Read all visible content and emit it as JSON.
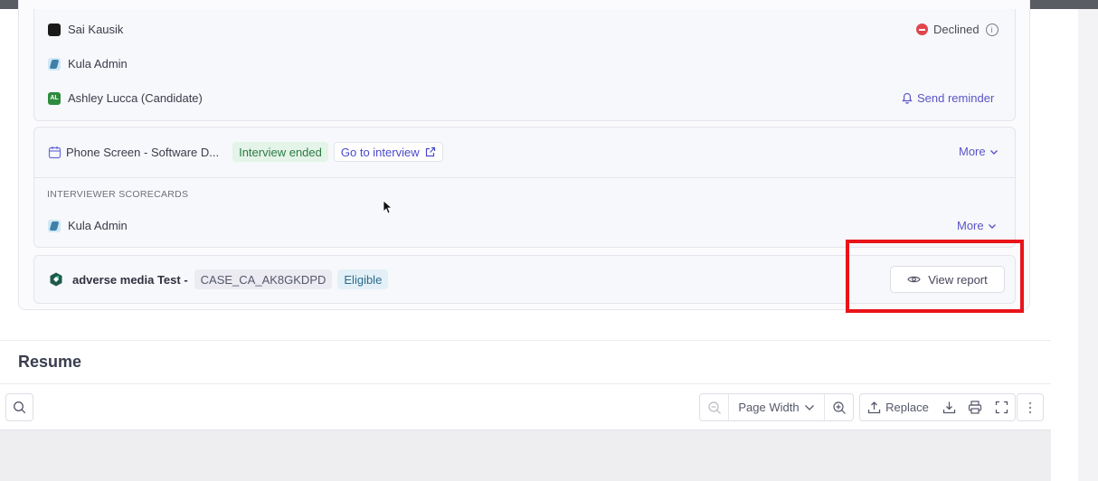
{
  "participants": [
    {
      "name": "Sai Kausik",
      "avatar": "black-logo",
      "status": "Declined"
    },
    {
      "name": "Kula Admin",
      "avatar": "kula-logo"
    },
    {
      "name": "Ashley Lucca (Candidate)",
      "avatar": "AL",
      "action": "Send reminder"
    }
  ],
  "interview": {
    "title": "Phone Screen - Software D...",
    "status_badge": "Interview ended",
    "go_label": "Go to interview",
    "more_label": "More",
    "scorecards_label": "INTERVIEWER SCORECARDS",
    "scorecard_name": "Kula Admin",
    "scorecard_more": "More"
  },
  "check": {
    "title": "adverse media Test -",
    "case_id": "CASE_CA_AK8GKDPD",
    "status": "Eligible",
    "view_report": "View report"
  },
  "resume": {
    "title": "Resume",
    "zoom_mode": "Page Width",
    "replace_label": "Replace"
  },
  "colors": {
    "accent": "#5a55c8",
    "declined": "#e0454b",
    "highlight": "#e8141a"
  }
}
